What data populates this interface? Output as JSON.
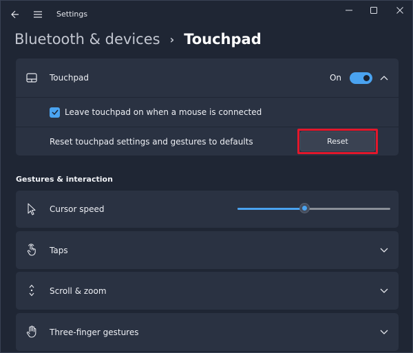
{
  "window": {
    "title": "Settings",
    "icons": [
      "back-arrow-icon",
      "hamburger-menu-icon",
      "minimize-icon",
      "maximize-icon",
      "close-icon"
    ]
  },
  "breadcrumb": {
    "parent": "Bluetooth & devices",
    "separator": "›",
    "current": "Touchpad"
  },
  "touchpad_card": {
    "label": "Touchpad",
    "icon": "touchpad-icon",
    "toggle_state_label": "On",
    "toggle_on": true,
    "leave_on_label": "Leave touchpad on when a mouse is connected",
    "leave_on_checked": true,
    "reset_description": "Reset touchpad settings and gestures to defaults",
    "reset_button_label": "Reset",
    "highlight_color": "#e3172b"
  },
  "section": {
    "title": "Gestures & interaction"
  },
  "items": [
    {
      "label": "Cursor speed",
      "icon": "cursor-icon"
    },
    {
      "label": "Taps",
      "icon": "tap-hand-icon"
    },
    {
      "label": "Scroll & zoom",
      "icon": "scroll-arrows-icon"
    },
    {
      "label": "Three-finger gestures",
      "icon": "hand-icon"
    }
  ],
  "cursor_speed": {
    "level": 0.44
  },
  "colors": {
    "accent": "#4aa3f0",
    "background": "#1f2634",
    "card": "#2a3242"
  }
}
